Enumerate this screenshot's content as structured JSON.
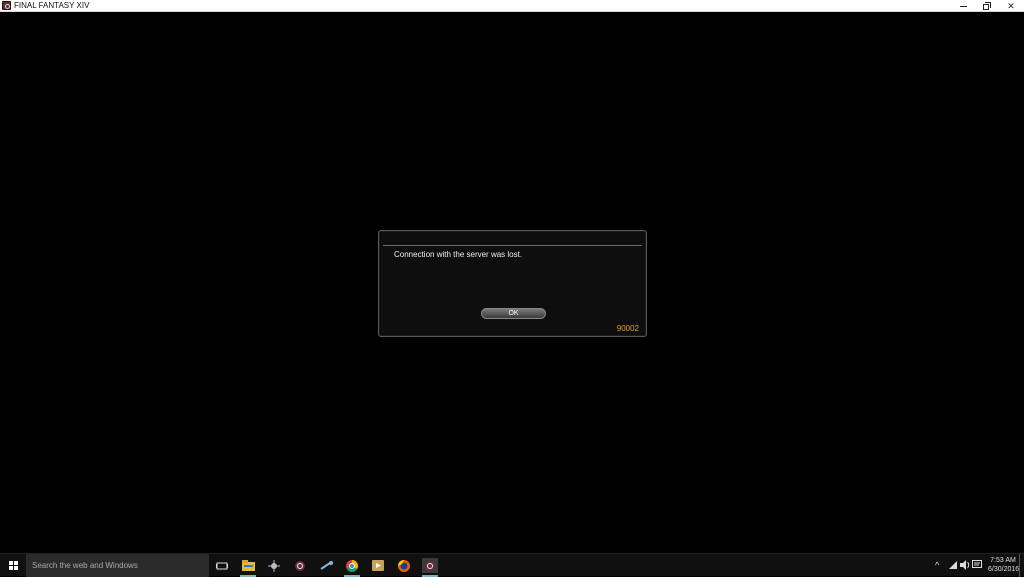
{
  "window": {
    "title": "FINAL FANTASY XIV",
    "minimize_icon": "minimize-icon",
    "maximize_icon": "restore-icon",
    "close_glyph": "✕"
  },
  "dialog": {
    "message": "Connection with the server was lost.",
    "ok_label": "OK",
    "error_code": "90002"
  },
  "taskbar": {
    "search_placeholder": "Search the web and Windows",
    "apps": [
      {
        "name": "task-view-icon"
      },
      {
        "name": "file-explorer-icon"
      },
      {
        "name": "app-icon"
      },
      {
        "name": "final-fantasy-icon"
      },
      {
        "name": "steam-icon"
      },
      {
        "name": "chrome-icon"
      },
      {
        "name": "media-player-icon"
      },
      {
        "name": "firefox-icon"
      },
      {
        "name": "final-fantasy-running-icon"
      }
    ],
    "tray": {
      "chevron": "^",
      "time": "7:53 AM",
      "date": "6/30/2016"
    }
  },
  "colors": {
    "error_code": "#e0a030",
    "dialog_bg": "#0e0e0e",
    "taskbar_bg": "#101010"
  }
}
